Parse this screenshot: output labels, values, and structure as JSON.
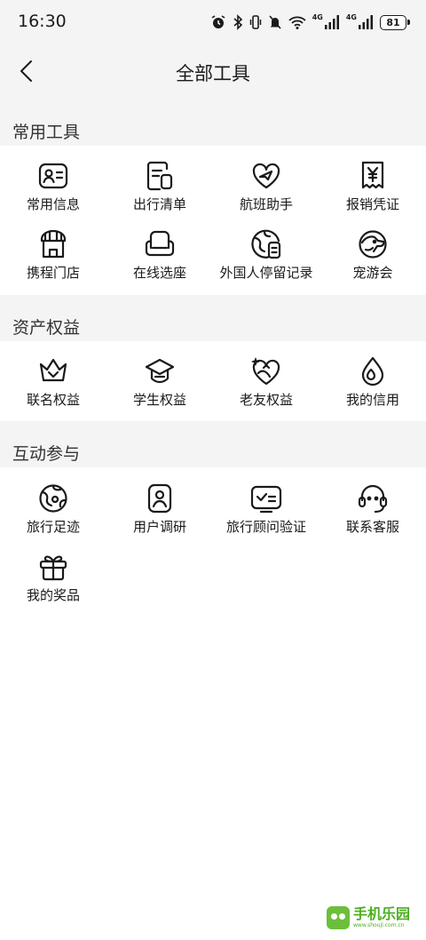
{
  "status_bar": {
    "time": "16:30",
    "signal1_label": "4G",
    "signal2_label": "4G",
    "battery": "81",
    "icons": [
      "alarm-icon",
      "bluetooth-icon",
      "vibrate-icon",
      "mute-icon",
      "wifi-icon",
      "signal-icon",
      "signal-icon",
      "battery-icon"
    ]
  },
  "header": {
    "title": "全部工具",
    "back_icon": "chevron-left-icon"
  },
  "sections": [
    {
      "title": "常用工具",
      "items": [
        {
          "label": "常用信息",
          "icon": "contact-card-icon"
        },
        {
          "label": "出行清单",
          "icon": "checklist-icon"
        },
        {
          "label": "航班助手",
          "icon": "heart-plane-icon"
        },
        {
          "label": "报销凭证",
          "icon": "receipt-yen-icon"
        },
        {
          "label": "携程门店",
          "icon": "storefront-icon"
        },
        {
          "label": "在线选座",
          "icon": "armchair-icon"
        },
        {
          "label": "外国人停留记录",
          "icon": "globe-document-icon"
        },
        {
          "label": "宠游会",
          "icon": "pet-dog-icon"
        }
      ]
    },
    {
      "title": "资产权益",
      "items": [
        {
          "label": "联名权益",
          "icon": "crown-icon"
        },
        {
          "label": "学生权益",
          "icon": "graduation-cap-icon"
        },
        {
          "label": "老友权益",
          "icon": "sparkle-heart-icon"
        },
        {
          "label": "我的信用",
          "icon": "water-drop-icon"
        }
      ]
    },
    {
      "title": "互动参与",
      "items": [
        {
          "label": "旅行足迹",
          "icon": "globe-icon"
        },
        {
          "label": "用户调研",
          "icon": "user-survey-icon"
        },
        {
          "label": "旅行顾问验证",
          "icon": "verify-card-icon"
        },
        {
          "label": "联系客服",
          "icon": "headset-icon"
        },
        {
          "label": "我的奖品",
          "icon": "gift-icon"
        }
      ]
    }
  ],
  "watermark": {
    "main": "手机乐园",
    "sub": "www.shoujl.com.cn"
  }
}
